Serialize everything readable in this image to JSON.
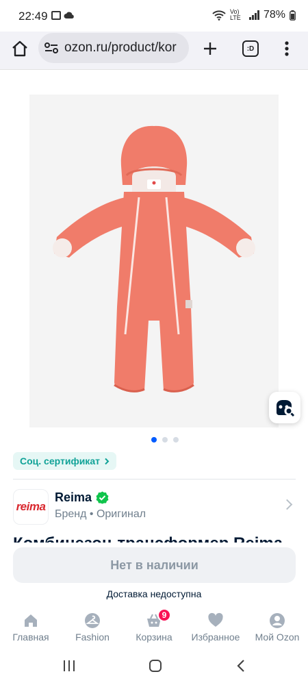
{
  "status_bar": {
    "time": "22:49",
    "network": "Vo) LTE",
    "battery": "78%"
  },
  "browser": {
    "url": "ozon.ru/product/kor",
    "tab_count_label": ":D"
  },
  "gallery": {
    "image_count": 3,
    "active_index": 0
  },
  "certificate": {
    "label": "Соц. сертификат"
  },
  "brand": {
    "logo_text": "reima",
    "name": "Reima",
    "subtitle": "Бренд • Оригинал"
  },
  "product": {
    "title": "Комбинезон-трансформер Reima"
  },
  "actions": {
    "out_of_stock_label": "Нет в наличии",
    "delivery_note": "Доставка недоступна"
  },
  "bottom_nav": {
    "items": [
      {
        "label": "Главная",
        "icon": "home-icon"
      },
      {
        "label": "Fashion",
        "icon": "hanger-icon"
      },
      {
        "label": "Корзина",
        "icon": "cart-icon",
        "badge": "9"
      },
      {
        "label": "Избранное",
        "icon": "heart-icon"
      },
      {
        "label": "Мой Ozon",
        "icon": "profile-icon"
      }
    ]
  },
  "colors": {
    "accent": "#005bff",
    "suit": "#f07c6a",
    "badge": "#f91155",
    "cert_text": "#10a297",
    "verified": "#10c44c"
  }
}
